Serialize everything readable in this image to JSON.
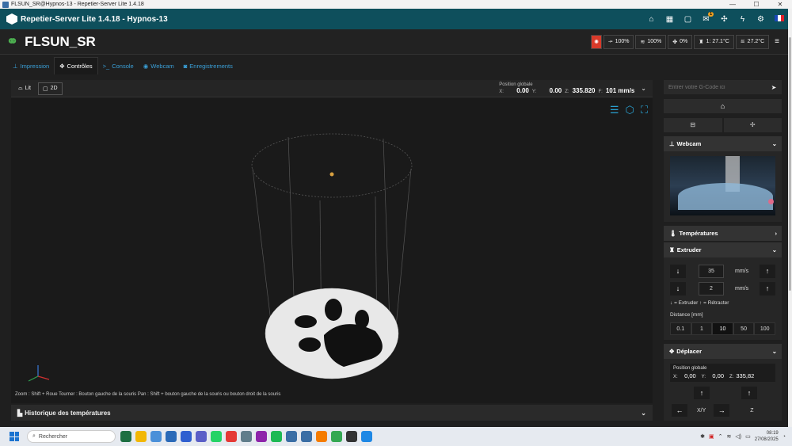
{
  "window": {
    "title": "FLSUN_SR@Hypnos-13 - Repetier-Server Lite 1.4.18",
    "controls": [
      "—",
      "☐",
      "✕"
    ]
  },
  "appbar": {
    "title": "Repetier-Server Lite 1.4.18 - Hypnos-13",
    "mail_badge": "1",
    "icons": [
      "home-icon",
      "printer-icon",
      "monitor-icon",
      "mail-icon",
      "network-icon",
      "bolt-icon",
      "gear-icon",
      "flag-icon"
    ]
  },
  "printer": {
    "name": "FLSUN_SR",
    "stats": [
      {
        "icon": "fan-speed-icon",
        "value": "100%"
      },
      {
        "icon": "flow-icon",
        "value": "100%"
      },
      {
        "icon": "fan-icon",
        "value": "0%"
      },
      {
        "icon": "extruder-temp-icon",
        "value": "1: 27.1°C"
      },
      {
        "icon": "bed-temp-icon",
        "value": "27.2°C"
      }
    ]
  },
  "tabs": [
    {
      "label": "Impression",
      "icon": "print-icon",
      "active": false
    },
    {
      "label": "Contrôles",
      "icon": "move-icon",
      "active": true
    },
    {
      "label": "Console",
      "icon": "console-icon",
      "active": false
    },
    {
      "label": "Webcam",
      "icon": "webcam-icon",
      "active": false
    },
    {
      "label": "Enregistrements",
      "icon": "camera-icon",
      "active": false
    }
  ],
  "toolbar": {
    "bed_label": "Lit",
    "view2d_label": "2D",
    "position_title": "Position globale",
    "x_label": "X:",
    "x": "0.00",
    "y_label": "Y:",
    "y": "0.00",
    "z_label": "Z:",
    "z": "335.820",
    "f_label": "F:",
    "f": "101 mm/s"
  },
  "viewport": {
    "hint": "Zoom : Shift + Roue Tourner : Bouton gauche de la souris Pan : Shift + bouton gauche de la souris ou bouton droit de la souris"
  },
  "history": {
    "label": "Historique des températures"
  },
  "right": {
    "gcode_placeholder": "Entrer votre G-Code ici",
    "webcam_label": "Webcam",
    "temps_label": "Températures",
    "extruder_label": "Extruder",
    "speed1": "35",
    "speed2": "2",
    "unit": "mm/s",
    "legend_extrude": "= Extruder",
    "legend_retract": "= Rétracter",
    "distance_label": "Distance [mm]",
    "steps": [
      "0.1",
      "1",
      "10",
      "50",
      "100"
    ],
    "move_label": "Déplacer",
    "move_pos_title": "Position globale",
    "mx_label": "X:",
    "mx": "0,00",
    "my_label": "Y:",
    "my": "0,00",
    "mz_label": "Z:",
    "mz": "335,82",
    "xy_label": "X/Y",
    "z_axis_label": "Z"
  },
  "taskbar": {
    "search_placeholder": "Rechercher",
    "time": "08:19",
    "date": "27/08/2025",
    "app_colors": [
      "#1d6f42",
      "#f2b705",
      "#4a90d9",
      "#2a6ab8",
      "#2f5fd0",
      "#5b5fc7",
      "#25d366",
      "#e53935",
      "#607d8b",
      "#8e24aa",
      "#1db954",
      "#3a6ea5",
      "#3a6ea5",
      "#f57c00",
      "#34a853",
      "#333333",
      "#1e88e5"
    ]
  },
  "colors": {
    "accent": "#3aa0d8",
    "appbar": "#0e4f5c",
    "panel": "#262626"
  }
}
